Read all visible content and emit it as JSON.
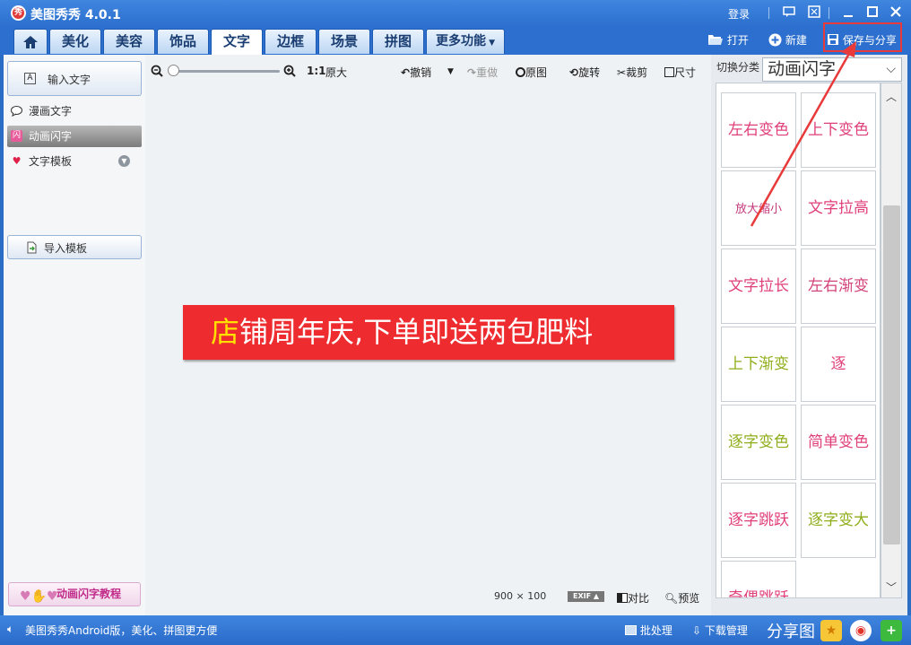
{
  "app": {
    "title": "美图秀秀 4.0.1",
    "logo_text": "秀"
  },
  "titlebar": {
    "login": "登录"
  },
  "tabs": [
    {
      "label": "美化"
    },
    {
      "label": "美容"
    },
    {
      "label": "饰品"
    },
    {
      "label": "文字"
    },
    {
      "label": "边框"
    },
    {
      "label": "场景"
    },
    {
      "label": "拼图"
    },
    {
      "label": "更多功能"
    }
  ],
  "toolbar": {
    "open": "打开",
    "new": "新建",
    "save_share": "保存与分享"
  },
  "left": {
    "input_text": "输入文字",
    "comic_text": "漫画文字",
    "anim_text": "动画闪字",
    "text_template": "文字模板",
    "import_template": "导入模板",
    "tutorial": "动画闪字教程"
  },
  "canvas_toolbar": {
    "zoom_ratio": "1:1",
    "original_size": "原大",
    "undo": "撤销",
    "redo": "重做",
    "original": "原图",
    "rotate": "旋转",
    "crop": "裁剪",
    "size": "尺寸"
  },
  "banner": {
    "first_char": "店",
    "rest": "铺周年庆,下单即送两包肥料"
  },
  "canvas_info": {
    "dims": "900 × 100",
    "exif": "EXIF",
    "compare": "对比",
    "preview": "预览"
  },
  "right": {
    "switch_label": "切换分类",
    "category": "动画闪字",
    "tiles": [
      {
        "text": "左右变色",
        "color": "#e0407a"
      },
      {
        "text": "上下变色",
        "color": "#e0407a"
      },
      {
        "text": "放大缩小",
        "color": "#c53a7e"
      },
      {
        "text": "文字拉高",
        "color": "#e0407a"
      },
      {
        "text": "文字拉长",
        "color": "#e0407a"
      },
      {
        "text": "左右渐变",
        "color": "#d3427a"
      },
      {
        "text": "上下渐变",
        "color": "#8fae1b"
      },
      {
        "text": "逐",
        "color": "#e0407a"
      },
      {
        "text": "逐字变色",
        "color": "#8fae1b"
      },
      {
        "text": "简单变色",
        "color": "#e0407a"
      },
      {
        "text": "逐字跳跃",
        "color": "#e0407a"
      },
      {
        "text": "逐字变大",
        "color": "#8fae1b"
      },
      {
        "text": "奇偶跳跃",
        "color": "#e0407a"
      }
    ]
  },
  "status": {
    "tip": "美图秀秀Android版，美化、拼图更方便",
    "batch": "批处理",
    "download": "下载管理",
    "share_image": "分享图"
  },
  "colors": {
    "title_blue": "#2c6fce",
    "banner_red": "#ee2b2f",
    "banner_highlight": "#ffe100",
    "highlight_red": "#e83a3a"
  }
}
